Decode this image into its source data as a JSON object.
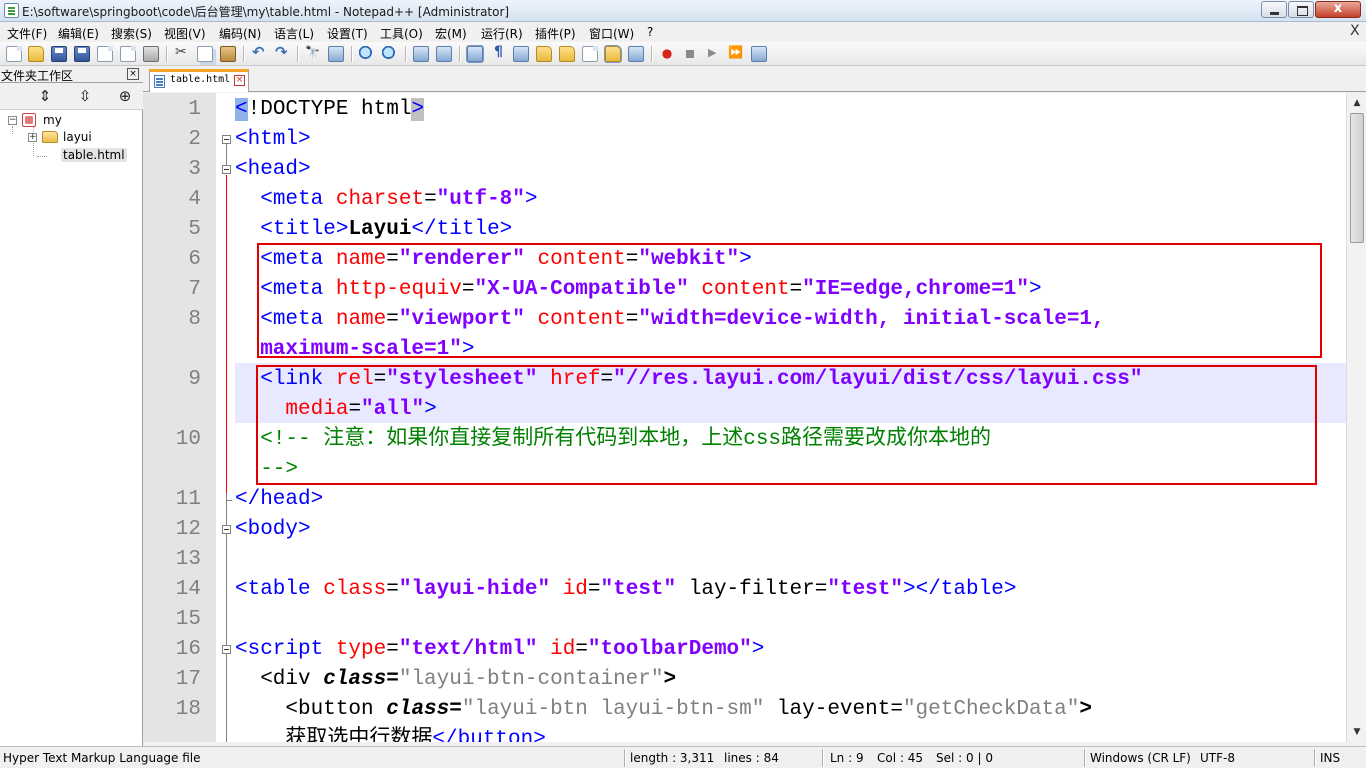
{
  "window": {
    "title": "E:\\software\\springboot\\code\\后台管理\\my\\table.html - Notepad++ [Administrator]",
    "close_glyph": "x"
  },
  "menu": {
    "items": [
      "文件(F)",
      "编辑(E)",
      "搜索(S)",
      "视图(V)",
      "编码(N)",
      "语言(L)",
      "设置(T)",
      "工具(O)",
      "宏(M)",
      "运行(R)",
      "插件(P)",
      "窗口(W)",
      "?"
    ],
    "close_glyph": "X"
  },
  "panel": {
    "title": "文件夹工作区",
    "close_glyph": "×",
    "tools": [
      "⇕",
      "⇳",
      "⊕"
    ],
    "tree": {
      "root": "my",
      "folder": "layui",
      "file": "table.html",
      "collapse_glyph": "−",
      "expand_glyph": "+"
    }
  },
  "tab": {
    "label": "table.html",
    "close_glyph": "×"
  },
  "editor": {
    "line_numbers": [
      "1",
      "2",
      "3",
      "4",
      "5",
      "6",
      "7",
      "8",
      "9",
      "10",
      "11",
      "12",
      "13",
      "14",
      "15",
      "16",
      "17",
      "18"
    ],
    "lines": [
      [
        {
          "s": "t",
          "x": "<"
        },
        {
          "s": "n",
          "x": "!DOCTYPE html"
        },
        {
          "s": "t",
          "x": ">"
        }
      ],
      [
        {
          "s": "t",
          "x": "<html>"
        }
      ],
      [
        {
          "s": "t",
          "x": "<head>"
        }
      ],
      [
        {
          "s": "n",
          "x": "  "
        },
        {
          "s": "t",
          "x": "<meta "
        },
        {
          "s": "a",
          "x": "charset"
        },
        {
          "s": "n",
          "x": "="
        },
        {
          "s": "v",
          "x": "\"utf-8\""
        },
        {
          "s": "t",
          "x": ">"
        }
      ],
      [
        {
          "s": "n",
          "x": "  "
        },
        {
          "s": "t",
          "x": "<title>"
        },
        {
          "s": "x",
          "x": "Layui"
        },
        {
          "s": "t",
          "x": "</title>"
        }
      ],
      [
        {
          "s": "n",
          "x": "  "
        },
        {
          "s": "t",
          "x": "<meta "
        },
        {
          "s": "a",
          "x": "name"
        },
        {
          "s": "n",
          "x": "="
        },
        {
          "s": "v",
          "x": "\"renderer\""
        },
        {
          "s": "n",
          "x": " "
        },
        {
          "s": "a",
          "x": "content"
        },
        {
          "s": "n",
          "x": "="
        },
        {
          "s": "v",
          "x": "\"webkit\""
        },
        {
          "s": "t",
          "x": ">"
        }
      ],
      [
        {
          "s": "n",
          "x": "  "
        },
        {
          "s": "t",
          "x": "<meta "
        },
        {
          "s": "a",
          "x": "http-equiv"
        },
        {
          "s": "n",
          "x": "="
        },
        {
          "s": "v",
          "x": "\"X-UA-Compatible\""
        },
        {
          "s": "n",
          "x": " "
        },
        {
          "s": "a",
          "x": "content"
        },
        {
          "s": "n",
          "x": "="
        },
        {
          "s": "v",
          "x": "\"IE=edge,chrome=1\""
        },
        {
          "s": "t",
          "x": ">"
        }
      ],
      [
        {
          "s": "n",
          "x": "  "
        },
        {
          "s": "t",
          "x": "<meta "
        },
        {
          "s": "a",
          "x": "name"
        },
        {
          "s": "n",
          "x": "="
        },
        {
          "s": "v",
          "x": "\"viewport\""
        },
        {
          "s": "n",
          "x": " "
        },
        {
          "s": "a",
          "x": "content"
        },
        {
          "s": "n",
          "x": "="
        },
        {
          "s": "v",
          "x": "\"width=device-width, initial-scale=1,"
        }
      ],
      [
        {
          "s": "v",
          "x": "  maximum-scale=1\""
        },
        {
          "s": "t",
          "x": ">"
        }
      ],
      [
        {
          "s": "n",
          "x": "  "
        },
        {
          "s": "t",
          "x": "<link "
        },
        {
          "s": "a",
          "x": "rel"
        },
        {
          "s": "n",
          "x": "="
        },
        {
          "s": "v",
          "x": "\"stylesheet\""
        },
        {
          "s": "n",
          "x": " "
        },
        {
          "s": "a",
          "x": "href"
        },
        {
          "s": "n",
          "x": "="
        },
        {
          "s": "v",
          "x": "\"//res.layui.com/layui/dist/css/layui.css\""
        }
      ],
      [
        {
          "s": "n",
          "x": "    "
        },
        {
          "s": "a",
          "x": "media"
        },
        {
          "s": "n",
          "x": "="
        },
        {
          "s": "v",
          "x": "\"all\""
        },
        {
          "s": "t",
          "x": ">"
        }
      ],
      [
        {
          "s": "n",
          "x": "  "
        },
        {
          "s": "c",
          "x": "<!-- 注意：如果你直接复制所有代码到本地，上述css路径需要改成你本地的"
        }
      ],
      [
        {
          "s": "c",
          "x": "  -->"
        }
      ],
      [
        {
          "s": "t",
          "x": "</head>"
        }
      ],
      [
        {
          "s": "t",
          "x": "<body>"
        }
      ],
      [],
      [
        {
          "s": "t",
          "x": "<table "
        },
        {
          "s": "a",
          "x": "class"
        },
        {
          "s": "n",
          "x": "="
        },
        {
          "s": "v",
          "x": "\"layui-hide\""
        },
        {
          "s": "n",
          "x": " "
        },
        {
          "s": "a",
          "x": "id"
        },
        {
          "s": "n",
          "x": "="
        },
        {
          "s": "v",
          "x": "\"test\""
        },
        {
          "s": "n",
          "x": " lay-filter="
        },
        {
          "s": "v",
          "x": "\"test\""
        },
        {
          "s": "t",
          "x": "></table>"
        }
      ],
      [],
      [
        {
          "s": "t",
          "x": "<script "
        },
        {
          "s": "a",
          "x": "type"
        },
        {
          "s": "n",
          "x": "="
        },
        {
          "s": "v",
          "x": "\"text/html\""
        },
        {
          "s": "n",
          "x": " "
        },
        {
          "s": "a",
          "x": "id"
        },
        {
          "s": "n",
          "x": "="
        },
        {
          "s": "v",
          "x": "\"toolbarDemo\""
        },
        {
          "s": "t",
          "x": ">"
        }
      ],
      [
        {
          "s": "n",
          "x": "  <div "
        },
        {
          "s": "ki",
          "x": "class"
        },
        {
          "s": "x",
          "x": "="
        },
        {
          "s": "g",
          "x": "\"layui-btn-container\""
        },
        {
          "s": "x",
          "x": ">"
        }
      ],
      [
        {
          "s": "n",
          "x": "    <button "
        },
        {
          "s": "ki",
          "x": "class"
        },
        {
          "s": "x",
          "x": "="
        },
        {
          "s": "g",
          "x": "\"layui-btn layui-btn-sm\""
        },
        {
          "s": "n",
          "x": " lay-event="
        },
        {
          "s": "g",
          "x": "\"getCheckData\""
        },
        {
          "s": "x",
          "x": ">"
        }
      ],
      [
        {
          "s": "n",
          "x": "    获取选中行数据"
        },
        {
          "s": "t",
          "x": "</button>"
        }
      ]
    ]
  },
  "status": {
    "file_type": "Hyper Text Markup Language file",
    "length": "length : 3,311",
    "lines": "lines : 84",
    "ln": "Ln : 9",
    "col": "Col : 45",
    "sel": "Sel : 0 | 0",
    "eol": "Windows (CR LF)",
    "encoding": "UTF-8",
    "mode": "INS"
  }
}
